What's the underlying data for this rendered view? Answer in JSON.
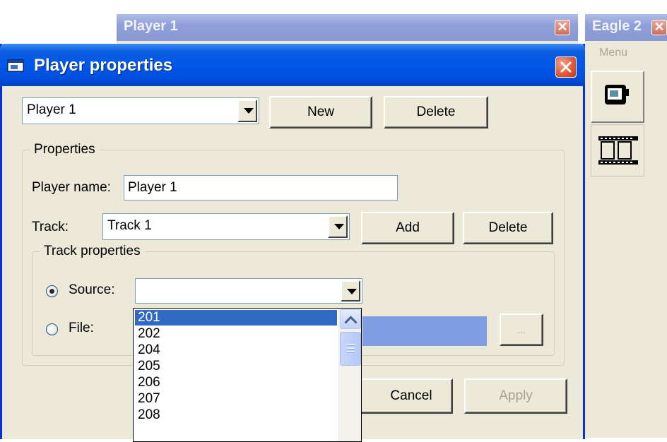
{
  "background_windows": {
    "player_window": {
      "title": "Player 1"
    },
    "eagle_window": {
      "title": "Eagle 2",
      "menu_label": "Menu"
    }
  },
  "dialog": {
    "title": "Player properties",
    "player_select": {
      "value": "Player 1"
    },
    "new_button": "New",
    "delete_button": "Delete",
    "properties_group": {
      "legend": "Properties",
      "player_name_label": "Player name:",
      "player_name_value": "Player 1",
      "track_label": "Track:",
      "track_value": "Track 1",
      "add_button": "Add",
      "delete_button": "Delete",
      "track_properties_group": {
        "legend": "Track properties",
        "source_label": "Source:",
        "source_value": "",
        "file_label": "File:",
        "browse_button": "..."
      }
    },
    "cancel_button": "Cancel",
    "apply_button": "Apply",
    "source_options": [
      "201",
      "202",
      "204",
      "205",
      "206",
      "207",
      "208"
    ],
    "selected_source_option": "201"
  },
  "colors": {
    "title_bar": "#0054e3",
    "dialog_bg": "#ece9d8",
    "selection": "#316ac5",
    "inactive_title": "#8f9fd8"
  }
}
